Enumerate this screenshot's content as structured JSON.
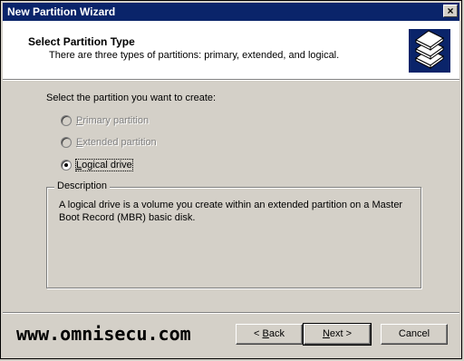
{
  "window": {
    "title": "New Partition Wizard",
    "close_label": "×"
  },
  "header": {
    "title": "Select Partition Type",
    "subtitle": "There are three types of partitions: primary, extended, and logical.",
    "icon": "stacked-disks-icon"
  },
  "body": {
    "prompt": "Select the partition you want to create:",
    "options": [
      {
        "label_u": "P",
        "label_rest": "rimary partition",
        "enabled": false,
        "selected": false
      },
      {
        "label_u": "E",
        "label_rest": "xtended partition",
        "enabled": false,
        "selected": false
      },
      {
        "label_u": "L",
        "label_rest": "ogical drive",
        "enabled": true,
        "selected": true
      }
    ],
    "description": {
      "label": "Description",
      "text": "A logical drive is a volume you create within an extended partition on a Master Boot Record (MBR) basic disk."
    }
  },
  "footer": {
    "watermark": "www.omnisecu.com",
    "back": {
      "prefix": "< ",
      "u": "B",
      "rest": "ack"
    },
    "next": {
      "u": "N",
      "rest": "ext >"
    },
    "cancel": "Cancel"
  },
  "colors": {
    "titlebar": "#0a246a",
    "face": "#d4d0c8",
    "header_bg": "#ffffff"
  }
}
